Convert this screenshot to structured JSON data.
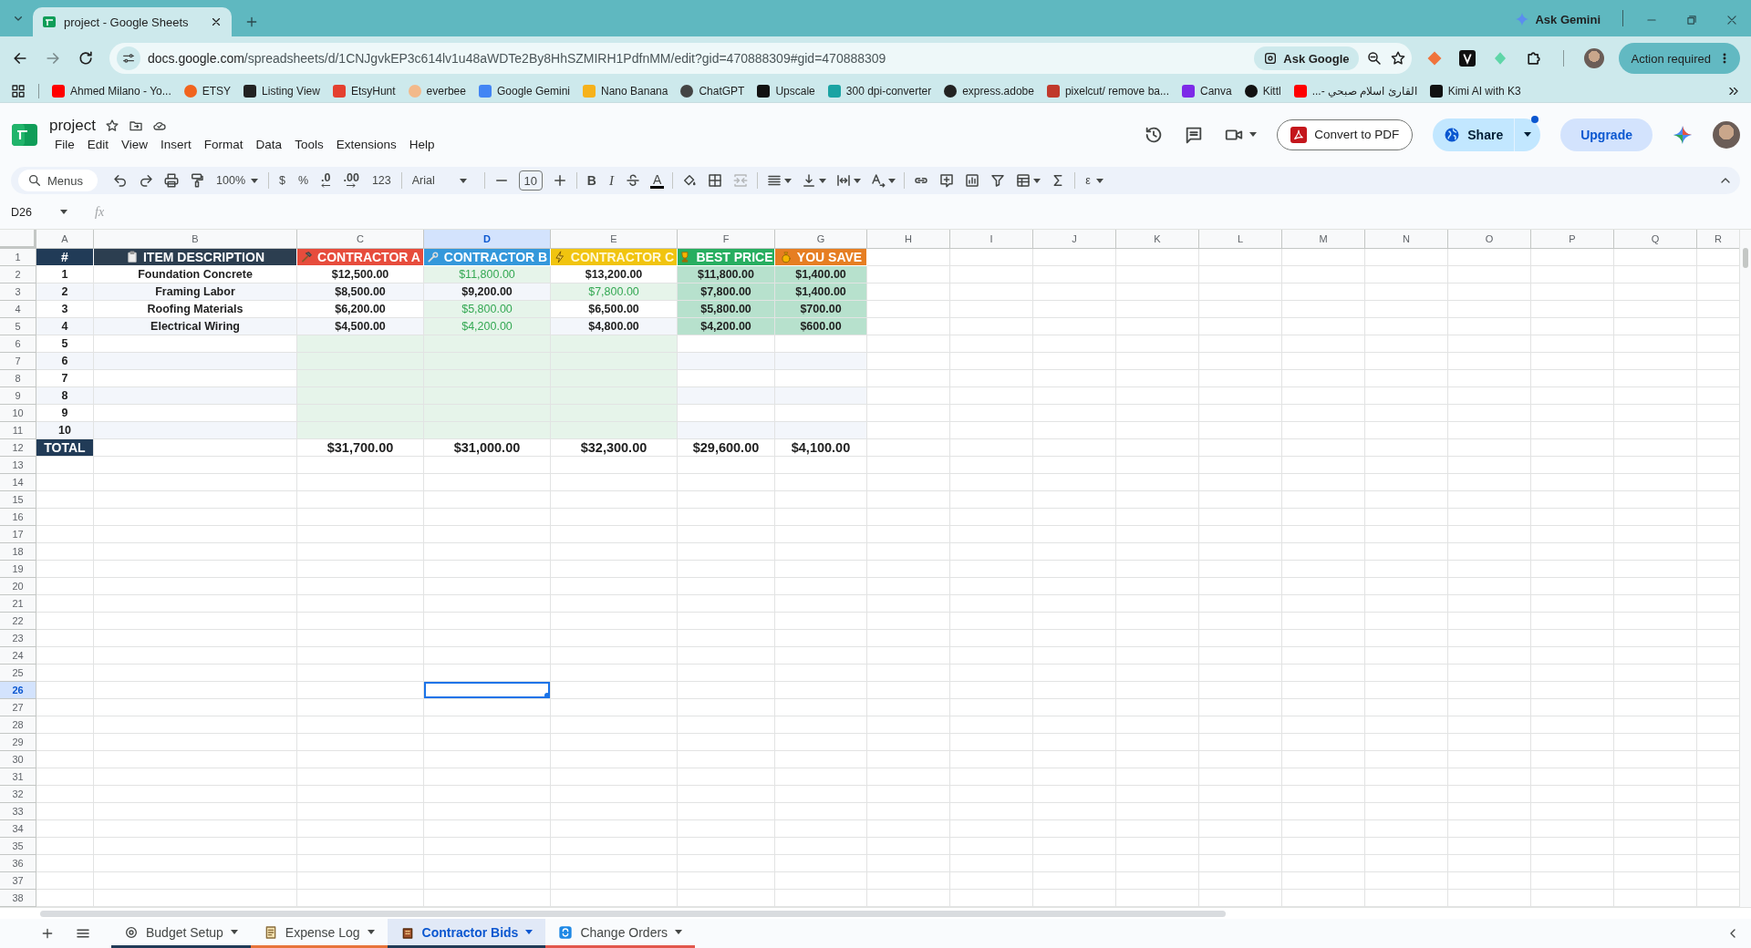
{
  "browser": {
    "tabs": [
      {
        "title": "project - Google Sheets",
        "selected": true
      }
    ],
    "address": {
      "host": "docs.google.com",
      "path": "/spreadsheets/d/1CNJgvkEP3c614lv1u48aWDTe2By8HhSZMIRH1PdfnMM/edit?gid=470888309#gid=470888309"
    },
    "ask_gemini": "Ask Gemini",
    "ask_google": "Ask Google",
    "action_required": "Action required",
    "bookmarks": [
      {
        "label": "Ahmed Milano - Yo..."
      },
      {
        "label": "ETSY"
      },
      {
        "label": "Listing View"
      },
      {
        "label": "EtsyHunt"
      },
      {
        "label": "everbee"
      },
      {
        "label": "Google Gemini"
      },
      {
        "label": "Nano Banana"
      },
      {
        "label": "ChatGPT"
      },
      {
        "label": "Upscale"
      },
      {
        "label": "300 dpi-converter"
      },
      {
        "label": "express.adobe"
      },
      {
        "label": "pixelcut/ remove ba..."
      },
      {
        "label": "Canva"
      },
      {
        "label": "Kittl"
      },
      {
        "label": "القارئ اسلام صبحي -..."
      },
      {
        "label": "Kimi AI with K3"
      }
    ]
  },
  "app": {
    "title": "project",
    "menu": [
      "File",
      "Edit",
      "View",
      "Insert",
      "Format",
      "Data",
      "Tools",
      "Extensions",
      "Help"
    ],
    "convert": "Convert to PDF",
    "share": "Share",
    "upgrade": "Upgrade"
  },
  "toolbar": {
    "groups": [
      [
        {
          "kind": "search",
          "label": "Menus"
        },
        {
          "kind": "undo"
        },
        {
          "kind": "redo"
        },
        {
          "kind": "print"
        },
        {
          "kind": "paint"
        },
        {
          "kind": "dropdown",
          "label": "100%"
        }
      ],
      [
        {
          "kind": "text",
          "label": "$"
        },
        {
          "kind": "text",
          "label": "%"
        },
        {
          "kind": "decimal-less",
          "label": ".0"
        },
        {
          "kind": "decimal-more",
          "label": ".00"
        },
        {
          "kind": "text",
          "label": "123"
        }
      ],
      [
        {
          "kind": "font",
          "label": "Arial"
        }
      ],
      [
        {
          "kind": "minus"
        },
        {
          "kind": "size",
          "label": "10"
        },
        {
          "kind": "plus"
        }
      ],
      [
        {
          "kind": "bold",
          "label": "B"
        },
        {
          "kind": "italic",
          "label": "I"
        },
        {
          "kind": "strike"
        },
        {
          "kind": "text-color",
          "label": "A"
        }
      ],
      [
        {
          "kind": "fill"
        },
        {
          "kind": "borders"
        },
        {
          "kind": "merge"
        }
      ],
      [
        {
          "kind": "align"
        },
        {
          "kind": "valign"
        },
        {
          "kind": "wrap"
        },
        {
          "kind": "rotate"
        }
      ],
      [
        {
          "kind": "link"
        },
        {
          "kind": "comment"
        },
        {
          "kind": "chart"
        },
        {
          "kind": "filter"
        },
        {
          "kind": "table"
        },
        {
          "kind": "sigma"
        }
      ],
      [
        {
          "kind": "dropdown",
          "label": "ε"
        }
      ]
    ]
  },
  "formula_bar": {
    "name_box": "D26",
    "function_label": "fx"
  },
  "sheet": {
    "columns": [
      {
        "letter": "A",
        "selected": false
      },
      {
        "letter": "B",
        "selected": false
      },
      {
        "letter": "C",
        "selected": false
      },
      {
        "letter": "D",
        "selected": true
      },
      {
        "letter": "E",
        "selected": false
      },
      {
        "letter": "F",
        "selected": false
      },
      {
        "letter": "G",
        "selected": false
      },
      {
        "letter": "H",
        "selected": false
      },
      {
        "letter": "I",
        "selected": false
      },
      {
        "letter": "J",
        "selected": false
      },
      {
        "letter": "K",
        "selected": false
      },
      {
        "letter": "L",
        "selected": false
      },
      {
        "letter": "M",
        "selected": false
      },
      {
        "letter": "N",
        "selected": false
      },
      {
        "letter": "O",
        "selected": false
      },
      {
        "letter": "P",
        "selected": false
      },
      {
        "letter": "Q",
        "selected": false
      },
      {
        "letter": "R",
        "selected": false
      }
    ],
    "rows": [
      {
        "number": "1",
        "selected": false,
        "kind": "header",
        "cells": [
          {
            "text": "#",
            "color": "#213b57"
          },
          {
            "text": "ITEM DESCRIPTION",
            "color": "#2c3e50"
          },
          {
            "text": "CONTRACTOR A",
            "color": "#e74c3c"
          },
          {
            "text": "CONTRACTOR B",
            "color": "#3498db"
          },
          {
            "text": "CONTRACTOR C",
            "color": "#f1c40f"
          },
          {
            "text": "BEST PRICE",
            "color": "#27ae60"
          },
          {
            "text": "YOU SAVE",
            "color": "#e67e22"
          }
        ]
      },
      {
        "number": "2",
        "selected": false,
        "kind": "item",
        "cells": [
          {
            "text": "1"
          },
          {
            "text": "Foundation Concrete"
          },
          {
            "text": "$12,500.00",
            "best": false
          },
          {
            "text": "$11,800.00",
            "best": true
          },
          {
            "text": "$13,200.00",
            "best": false
          },
          {
            "text": "$11,800.00"
          },
          {
            "text": "$1,400.00"
          }
        ]
      },
      {
        "number": "3",
        "selected": false,
        "kind": "item",
        "cells": [
          {
            "text": "2"
          },
          {
            "text": "Framing Labor"
          },
          {
            "text": "$8,500.00",
            "best": false
          },
          {
            "text": "$9,200.00",
            "best": false
          },
          {
            "text": "$7,800.00",
            "best": true
          },
          {
            "text": "$7,800.00"
          },
          {
            "text": "$1,400.00"
          }
        ]
      },
      {
        "number": "4",
        "selected": false,
        "kind": "item",
        "cells": [
          {
            "text": "3"
          },
          {
            "text": "Roofing Materials"
          },
          {
            "text": "$6,200.00",
            "best": false
          },
          {
            "text": "$5,800.00",
            "best": true
          },
          {
            "text": "$6,500.00",
            "best": false
          },
          {
            "text": "$5,800.00"
          },
          {
            "text": "$700.00"
          }
        ]
      },
      {
        "number": "5",
        "selected": false,
        "kind": "item",
        "cells": [
          {
            "text": "4"
          },
          {
            "text": "Electrical Wiring"
          },
          {
            "text": "$4,500.00",
            "best": false
          },
          {
            "text": "$4,200.00",
            "best": true
          },
          {
            "text": "$4,800.00",
            "best": false
          },
          {
            "text": "$4,200.00"
          },
          {
            "text": "$600.00"
          }
        ]
      },
      {
        "number": "6",
        "selected": false,
        "kind": "blank",
        "cells": [
          {
            "text": "5"
          },
          {
            "best": false
          },
          {
            "best": true
          },
          {
            "best": true
          },
          {
            "best": true
          },
          {
            "best": false
          },
          {
            "best": false
          }
        ]
      },
      {
        "number": "7",
        "selected": false,
        "kind": "blank",
        "cells": [
          {
            "text": "6"
          },
          {
            "best": false
          },
          {
            "best": true
          },
          {
            "best": true
          },
          {
            "best": true
          },
          {
            "best": false
          },
          {
            "best": false
          }
        ]
      },
      {
        "number": "8",
        "selected": false,
        "kind": "blank",
        "cells": [
          {
            "text": "7"
          },
          {
            "best": false
          },
          {
            "best": true
          },
          {
            "best": true
          },
          {
            "best": true
          },
          {
            "best": false
          },
          {
            "best": false
          }
        ]
      },
      {
        "number": "9",
        "selected": false,
        "kind": "blank",
        "cells": [
          {
            "text": "8"
          },
          {
            "best": false
          },
          {
            "best": true
          },
          {
            "best": true
          },
          {
            "best": true
          },
          {
            "best": false
          },
          {
            "best": false
          }
        ]
      },
      {
        "number": "10",
        "selected": false,
        "kind": "blank",
        "cells": [
          {
            "text": "9"
          },
          {
            "best": false
          },
          {
            "best": true
          },
          {
            "best": true
          },
          {
            "best": true
          },
          {
            "best": false
          },
          {
            "best": false
          }
        ]
      },
      {
        "number": "11",
        "selected": false,
        "kind": "blank",
        "cells": [
          {
            "text": "10"
          },
          {
            "best": false
          },
          {
            "best": true
          },
          {
            "best": true
          },
          {
            "best": true
          },
          {
            "best": false
          },
          {
            "best": false
          }
        ]
      },
      {
        "number": "12",
        "selected": false,
        "kind": "total",
        "cells": [
          {
            "text": "TOTAL"
          },
          {
            "best": false
          },
          {
            "text": "$31,700.00"
          },
          {
            "text": "$31,000.00"
          },
          {
            "text": "$32,300.00"
          },
          {
            "text": "$29,600.00"
          },
          {
            "text": "$4,100.00"
          }
        ]
      },
      {
        "number": "13",
        "selected": false
      },
      {
        "number": "14",
        "selected": false
      },
      {
        "number": "15",
        "selected": false
      },
      {
        "number": "16",
        "selected": false
      },
      {
        "number": "17",
        "selected": false
      },
      {
        "number": "18",
        "selected": false
      },
      {
        "number": "19",
        "selected": false
      },
      {
        "number": "20",
        "selected": false
      },
      {
        "number": "21",
        "selected": false
      },
      {
        "number": "22",
        "selected": false
      },
      {
        "number": "23",
        "selected": false
      },
      {
        "number": "24",
        "selected": false
      },
      {
        "number": "25",
        "selected": false
      },
      {
        "number": "26",
        "selected": true
      },
      {
        "number": "27",
        "selected": false
      },
      {
        "number": "28",
        "selected": false
      },
      {
        "number": "29",
        "selected": false
      },
      {
        "number": "30",
        "selected": false
      },
      {
        "number": "31",
        "selected": false
      },
      {
        "number": "32",
        "selected": false
      },
      {
        "number": "33",
        "selected": false
      },
      {
        "number": "34",
        "selected": false
      },
      {
        "number": "35",
        "selected": false
      },
      {
        "number": "36",
        "selected": false
      },
      {
        "number": "37",
        "selected": false
      },
      {
        "number": "38",
        "selected": false
      }
    ]
  },
  "sheet_tabs": [
    {
      "label": "Budget Setup",
      "selected": false,
      "color": "#213b57"
    },
    {
      "label": "Expense Log",
      "selected": false,
      "color": "#e8743b"
    },
    {
      "label": "Contractor Bids",
      "selected": true,
      "color": "#213b57"
    },
    {
      "label": "Change Orders",
      "selected": false,
      "color": "#e2574c"
    }
  ]
}
